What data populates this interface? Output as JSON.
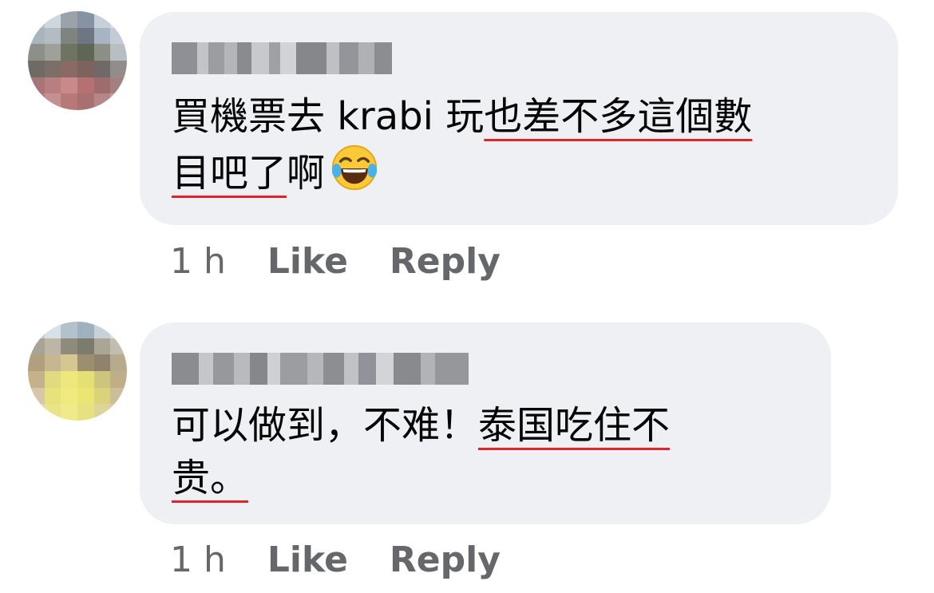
{
  "comments": [
    {
      "author": "",
      "text_line1_plain": "買機票去 krabi 玩",
      "text_line1_underlined": "也差不多這個數",
      "text_line2_underlined": "目吧了",
      "text_line2_plain": "啊",
      "emoji": "face-with-tears-of-joy",
      "time": "1 h",
      "like_label": "Like",
      "reply_label": "Reply"
    },
    {
      "author": "",
      "text_line1_plain": "可以做到，不难！",
      "text_line1_underlined": "泰国吃住不",
      "text_line2_underlined": "贵。",
      "text_line2_plain": "",
      "time": "1 h",
      "like_label": "Like",
      "reply_label": "Reply"
    }
  ],
  "colors": {
    "bubble": "#eff0f4",
    "text": "#050505",
    "meta": "#65676b",
    "spellcheck_underline": "#e0242a"
  }
}
